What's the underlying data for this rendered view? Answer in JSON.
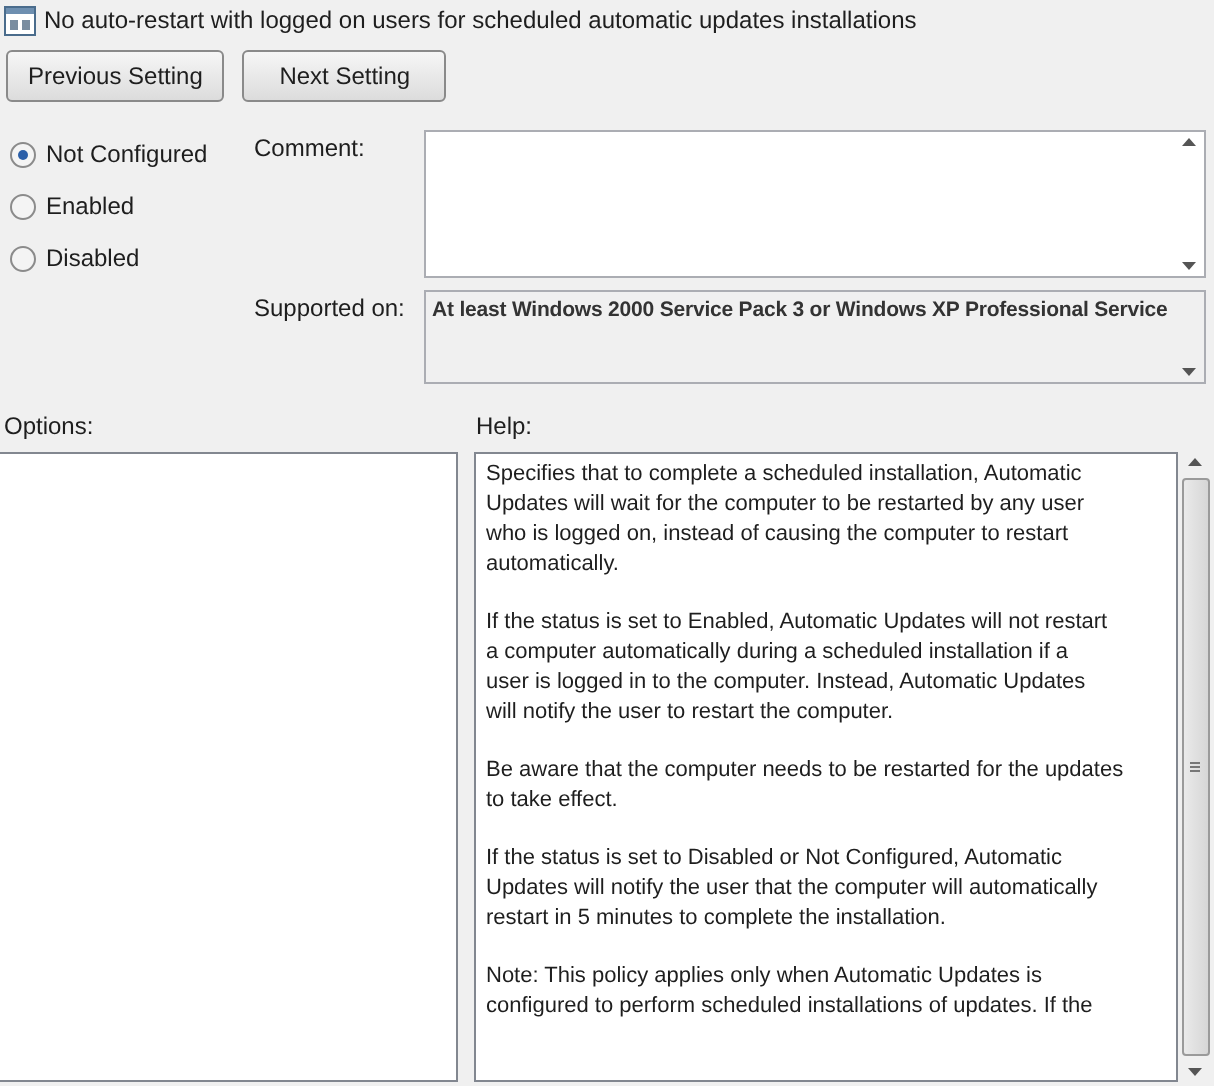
{
  "window": {
    "title": "No auto-restart with logged on users for scheduled automatic updates installations"
  },
  "nav_buttons": [
    "Previous Setting",
    "Next Setting"
  ],
  "state_options": [
    {
      "label": "Not Configured",
      "selected": true
    },
    {
      "label": "Enabled",
      "selected": false
    },
    {
      "label": "Disabled",
      "selected": false
    }
  ],
  "comment": {
    "label": "Comment:"
  },
  "supported_on": {
    "label": "Supported on:",
    "value": "At least Windows 2000 Service Pack 3 or Windows XP Professional Service"
  },
  "options": {
    "label": "Options:"
  },
  "help": {
    "label": "Help:",
    "paragraphs": [
      "Specifies that to complete a scheduled installation, Automatic\nUpdates will wait for the computer to be restarted by any user\nwho is logged on, instead of causing the computer to restart\nautomatically.",
      "If the status is set to Enabled, Automatic Updates will not restart\na computer automatically during a scheduled installation if a\nuser is logged in to the computer. Instead, Automatic Updates\nwill notify the user to restart the computer.",
      "Be aware that the computer needs to be restarted for the updates\nto take effect.",
      "If the status is set to Disabled or Not Configured, Automatic\nUpdates will notify the user that the computer will automatically\nrestart in 5 minutes to complete the installation.",
      "Note: This policy applies only when Automatic Updates is\nconfigured to perform scheduled installations of updates. If the"
    ]
  }
}
